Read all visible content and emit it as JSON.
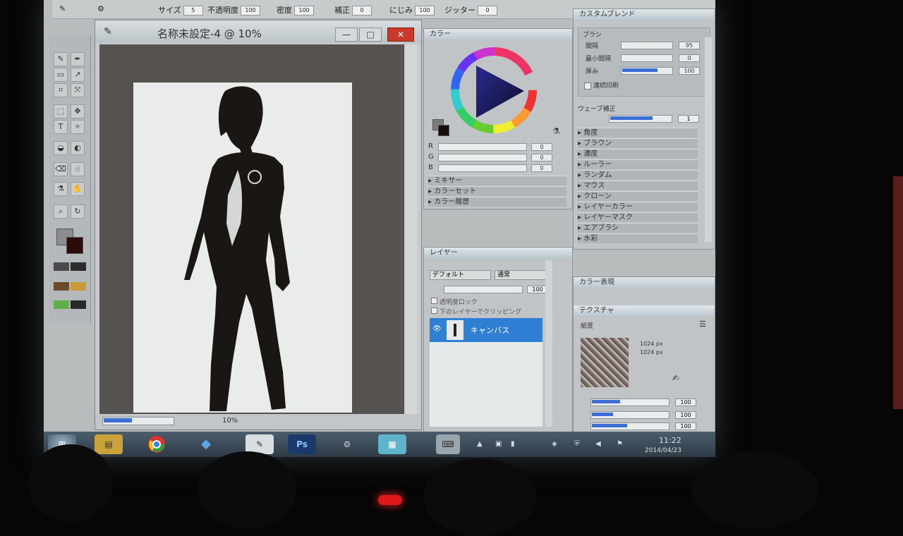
{
  "options_bar": {
    "size_label": "サイズ",
    "size_value": "5",
    "min_size_label": "不透明度",
    "min_size_value": "100",
    "density_label": "密度",
    "density_value": "100",
    "correction_label": "補正",
    "correction_value": "0",
    "blend_label": "にじみ",
    "blend_value": "100",
    "jitter_label": "ジッター",
    "jitter_value": "0"
  },
  "canvas_window": {
    "title": "名称未設定-4 @ 10%",
    "zoom_text": "10%",
    "min_icon": "—",
    "max_icon": "□",
    "close_icon": "✕"
  },
  "color_panel": {
    "title": "カラー",
    "sliders": [
      {
        "label": "R",
        "value": "0"
      },
      {
        "label": "G",
        "value": "0"
      },
      {
        "label": "B",
        "value": "0"
      }
    ],
    "sections": [
      "ミキサー",
      "カラーセット",
      "カラー履歴"
    ]
  },
  "brush_panel": {
    "title": "カスタムブレンド",
    "sub": "ブラシ",
    "params": [
      {
        "label": "間隔",
        "value": "95"
      },
      {
        "label": "最小間隔",
        "value": "0"
      },
      {
        "label": "厚み",
        "value": "100"
      }
    ],
    "checkbox_label": "連続印刷",
    "pen_section": "ウェーブ補正",
    "pen_value": "1",
    "list": [
      "角度",
      "ブラウン",
      "濃度",
      "ルーラー",
      "ランダム",
      "マウス",
      "クローン",
      "レイヤーカラー",
      "レイヤーマスク",
      "エアブラシ",
      "水彩"
    ]
  },
  "layer_panel": {
    "title": "レイヤー",
    "blend_mode": "デフォルト",
    "mode2": "通常",
    "opacity": "100",
    "opt1": "透明度ロック",
    "opt2": "下のレイヤーでクリッピング",
    "layer_name": "キャンバス"
  },
  "texture_panel": {
    "title_collapsed": "カラー表現",
    "title": "テクスチャ",
    "label": "紙質",
    "info1": "1024 px",
    "info2": "1024 px",
    "sliders": [
      "100",
      "100",
      "100"
    ]
  },
  "taskbar": {
    "apps": [
      "Chrome",
      "Dropbox",
      "Ps"
    ],
    "time": "11:22",
    "date": "2014/04/23"
  },
  "colors": {
    "accent": "#3b6fd6",
    "close_red": "#c93a2a",
    "layer_selected": "#2f7fd4"
  }
}
